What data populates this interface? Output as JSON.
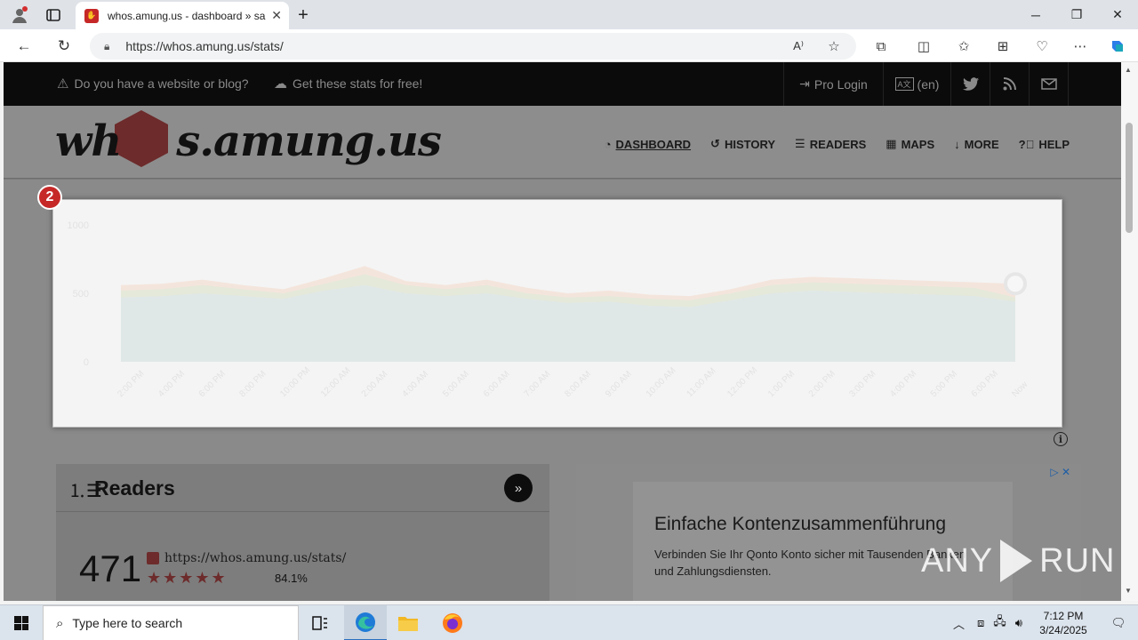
{
  "browser": {
    "tab_title": "whos.amung.us - dashboard » sa",
    "url": "https://whos.amung.us/stats/",
    "read_aloud_label": "A⁾"
  },
  "topbar": {
    "website_msg": "Do you have a website or blog?",
    "stats_msg": "Get these stats for free!",
    "login": "Pro Login",
    "language": "(en)"
  },
  "site": {
    "logo_left": "wh",
    "logo_right": "s.amung.us"
  },
  "nav": {
    "items": [
      {
        "label": "DASHBOARD",
        "icon": "dashboard-icon"
      },
      {
        "label": "HISTORY",
        "icon": "history-icon"
      },
      {
        "label": "READERS",
        "icon": "readers-icon"
      },
      {
        "label": "MAPS",
        "icon": "maps-icon"
      },
      {
        "label": "MORE",
        "icon": "arrow-down-icon"
      },
      {
        "label": "HELP",
        "icon": "help-icon"
      }
    ]
  },
  "step_badge": "2",
  "chart_data": {
    "type": "area",
    "yticks": [
      "1000",
      "500",
      "0"
    ],
    "ylim": [
      0,
      1000
    ],
    "x": [
      "2:00 PM",
      "4:00 PM",
      "6:00 PM",
      "8:00 PM",
      "10:00 PM",
      "12:00 AM",
      "2:00 AM",
      "4:00 AM",
      "5:00 AM",
      "6:00 AM",
      "7:00 AM",
      "8:00 AM",
      "9:00 AM",
      "10:00 AM",
      "11:00 AM",
      "12:00 PM",
      "1:00 PM",
      "2:00 PM",
      "3:00 PM",
      "4:00 PM",
      "5:00 PM",
      "6:00 PM",
      "Now"
    ],
    "series": [
      {
        "name": "",
        "color": "#f4d9c8",
        "values": [
          560,
          570,
          600,
          560,
          530,
          610,
          700,
          590,
          560,
          600,
          540,
          500,
          520,
          490,
          480,
          530,
          600,
          620,
          610,
          600,
          590,
          580,
          570
        ]
      },
      {
        "name": "",
        "color": "#d9ecd9",
        "values": [
          520,
          530,
          560,
          530,
          500,
          570,
          640,
          560,
          530,
          560,
          500,
          470,
          480,
          460,
          450,
          500,
          560,
          580,
          570,
          560,
          550,
          540,
          470
        ]
      },
      {
        "name": "",
        "color": "#dde8f3",
        "values": [
          470,
          480,
          500,
          480,
          460,
          520,
          560,
          500,
          480,
          500,
          460,
          430,
          440,
          410,
          400,
          450,
          500,
          520,
          510,
          500,
          490,
          480,
          440
        ]
      }
    ],
    "grid": false
  },
  "readers": {
    "title": "Readers",
    "count": "471",
    "url": "https://whos.amung.us/stats/",
    "stars": "★★★★★",
    "percent": "84.1%"
  },
  "ad": {
    "title": "Einfache Kontenzusammenführung",
    "body": "Verbinden Sie Ihr Qonto Konto sicher mit Tausenden Banken und Zahlungsdiensten."
  },
  "watermark": {
    "left": "ANY",
    "right": "RUN"
  },
  "taskbar": {
    "search_placeholder": "Type here to search",
    "time": "7:12 PM",
    "date": "3/24/2025"
  }
}
